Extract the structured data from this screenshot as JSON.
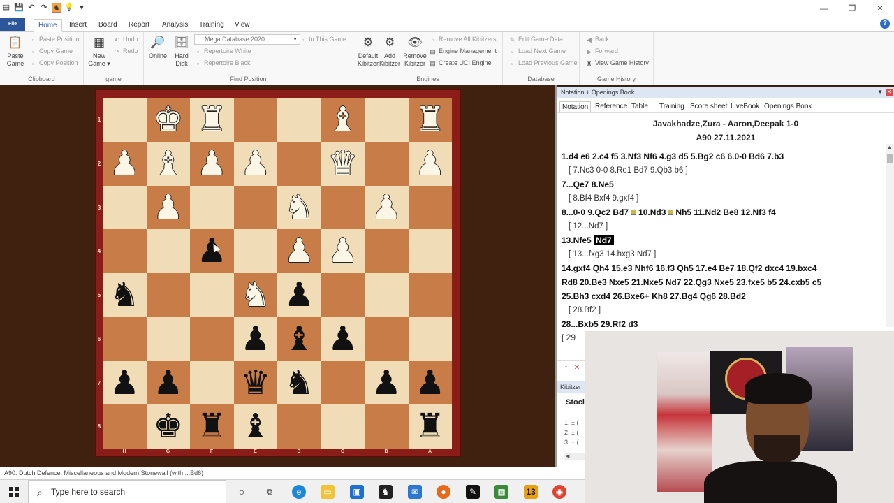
{
  "titlebar": {
    "qat_icons": [
      "menu-icon",
      "save-icon",
      "undo-icon",
      "redo-icon",
      "fritz-icon",
      "bulb-icon"
    ],
    "controls": [
      "—",
      "❐",
      "✕"
    ]
  },
  "tabs": {
    "file": "File",
    "items": [
      "Home",
      "Insert",
      "Board",
      "Report",
      "Analysis",
      "Training",
      "View"
    ]
  },
  "ribbon": {
    "clipboard": {
      "paste_game": "Paste Game",
      "paste_position": "Paste Position",
      "copy_game": "Copy Game",
      "copy_position": "Copy Position",
      "label": "Clipboard"
    },
    "game": {
      "new_game": "New Game",
      "undo": "Undo",
      "redo": "Redo",
      "label": "game"
    },
    "find": {
      "online": "Online",
      "hard_disk": "Hard Disk",
      "database": "Mega Database 2020",
      "in_this_game": "In This Game",
      "rep_white": "Repertoire White",
      "rep_black": "Repertoire Black",
      "label": "Find Position"
    },
    "engines": {
      "default_kib": "Default Kibitzer",
      "add_kib": "Add Kibitzer",
      "remove_kib": "Remove Kibitzer",
      "remove_all": "Remove All Kibitzers",
      "engine_mgmt": "Engine Management",
      "create_uci": "Create UCI Engine",
      "label": "Engines"
    },
    "database": {
      "edit": "Edit Game Data",
      "load_next": "Load Next Game",
      "load_prev": "Load Previous Game",
      "label": "Database"
    },
    "history": {
      "back": "Back",
      "forward": "Forward",
      "view": "View Game History",
      "label": "Game History"
    }
  },
  "board": {
    "ranks": [
      "1",
      "2",
      "3",
      "4",
      "5",
      "6",
      "7",
      "8"
    ],
    "files": [
      "H",
      "G",
      "F",
      "E",
      "D",
      "C",
      "B",
      "A"
    ]
  },
  "notation": {
    "panel_title": "Notation + Openings Book",
    "tabs": [
      "Notation",
      "Reference",
      "Table",
      "Training",
      "Score sheet",
      "LiveBook",
      "Openings Book"
    ],
    "players": "Javakhadze,Zura - Aaron,Deepak 1-0",
    "eco_date": "A90 27.11.2021",
    "lines": {
      "l1": "1.d4  e6  2.c4  f5  3.Nf3  Nf6  4.g3  d5  5.Bg2  c6  6.0-0  Bd6  7.b3",
      "l2": "[ 7.Nc3  0-0  8.Re1  Bd7  9.Qb3  b6 ]",
      "l3": "7...Qe7  8.Ne5",
      "l4": "[ 8.Bf4  Bxf4  9.gxf4 ]",
      "l5a": "8...0-0  9.Qc2  Bd7",
      "l5b": "10.Nd3",
      "l5c": "Nh5  11.Nd2  Be8  12.Nf3  f4",
      "l6": "[ 12...Nd7 ]",
      "l7a": "13.Nfe5",
      "l7b": "Nd7",
      "l8": "[ 13...fxg3  14.hxg3  Nd7 ]",
      "l9": "14.gxf4  Qh4  15.e3  Nhf6  16.f3  Qh5  17.e4  Be7  18.Qf2  dxc4  19.bxc4",
      "l10": "Rd8  20.Be3  Nxe5  21.Nxe5  Nd7  22.Qg3  Nxe5  23.fxe5  b5  24.cxb5  c5",
      "l11": "25.Bh3  cxd4  26.Bxe6+  Kh8  27.Bg4  Qg6  28.Bd2",
      "l12": "[ 28.Bf2 ]",
      "l13": "28...Bxb5  29.Rf2  d3",
      "l14": "[ 29"
    }
  },
  "kibitzer": {
    "title": "Kibitzer",
    "engine": "Stocl",
    "lines": [
      "1. ± (",
      "2. ± (",
      "3. ± ("
    ],
    "nav_up": "↑",
    "nav_close": "✕"
  },
  "status": "A90: Dutch Defence: Miscellaneous and Modern Stonewall (with ...Bd6)",
  "taskbar": {
    "search_placeholder": "Type here to search"
  }
}
